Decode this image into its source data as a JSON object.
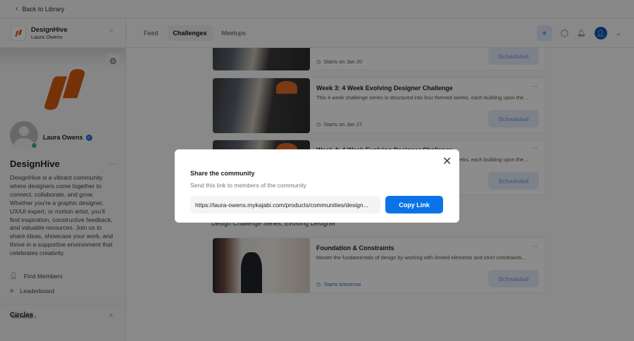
{
  "topbar": {
    "back_label": "Back to Library"
  },
  "sidebar": {
    "community_name": "DesignHive",
    "owner": "Laura Owens",
    "profile_name": "Laura Owens",
    "title": "DesignHive",
    "description": "DesignHive is a vibrant community where designers come together to connect, collaborate, and grow. Whether you're a graphic designer, UX/UI expert, or motion artist, you'll find inspiration, constructive feedback, and valuable resources. Join us to share ideas, showcase your work, and thrive in a supportive environment that celebrates creativity.",
    "nav": [
      {
        "label": "Find Members",
        "icon": "user-icon"
      },
      {
        "label": "Leaderboard",
        "icon": "bar-chart-icon"
      }
    ],
    "circles_title": "Circles",
    "circles": [
      {
        "label": "General"
      }
    ],
    "brand_color": "#d95a12"
  },
  "header": {
    "tabs": [
      {
        "label": "Feed"
      },
      {
        "label": "Challenges",
        "active": true
      },
      {
        "label": "Meetups"
      }
    ]
  },
  "cards": [
    {
      "title": "",
      "description": "",
      "start": "Starts on Jan 20",
      "status": "Scheduled"
    },
    {
      "title": "Week 3: 4 Week Evolving Designer Challenge",
      "description": "This 4 week challenge series is structured into four themed weeks, each building upon the...",
      "start": "Starts on Jan 27",
      "status": "Scheduled"
    },
    {
      "title": "Week 4: 4 Week Evolving Designer Challenge",
      "description": "This 4 week challenge series is structured into four themed weeks, each building upon the...",
      "start": "",
      "status": "Scheduled"
    }
  ],
  "section": {
    "title": "Design Challenge Series: Evolving Designer",
    "cards": [
      {
        "title": "Foundation & Constraints",
        "description": "Master the fundamentals of design by working with limited elements and strict constraints...",
        "start": "Starts tomorrow",
        "status": "Scheduled"
      }
    ]
  },
  "modal": {
    "title": "Share the community",
    "subtitle": "Send this link to members of the community",
    "link": "https://laura-owens.mykajabi.com/products/communities/design...",
    "copy_label": "Copy Link",
    "accent": "#0a73e8"
  }
}
